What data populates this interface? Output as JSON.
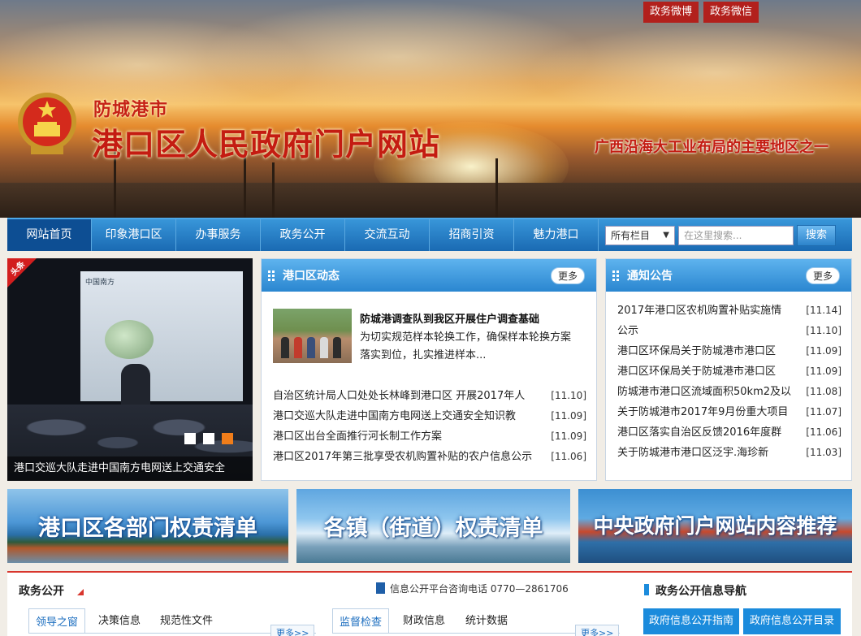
{
  "header": {
    "top_links": [
      "政务微博",
      "政务微信"
    ],
    "city": "防城港市",
    "site_title": "港口区人民政府门户网站",
    "slogan": "广西沿海大工业布局的主要地区之一"
  },
  "nav": {
    "items": [
      "网站首页",
      "印象港口区",
      "办事服务",
      "政务公开",
      "交流互动",
      "招商引资",
      "魅力港口"
    ],
    "active_index": 0,
    "select_value": "所有栏目",
    "search_placeholder": "在这里搜索...",
    "search_button": "搜索"
  },
  "slider": {
    "badge": "头条",
    "caption": "港口交巡大队走进中国南方电网送上交通安全",
    "screen_logo": "中国南方",
    "dots": 3,
    "active_dot": 2
  },
  "news_panel": {
    "title": "港口区动态",
    "more": "更多",
    "feature": {
      "title": "防城港调查队到我区开展住户调查基础",
      "text": "为切实规范样本轮换工作，确保样本轮换方案落实到位，扎实推进样本..."
    },
    "items": [
      {
        "title": "自治区统计局人口处处长林峰到港口区 开展2017年人",
        "date": "[11.10]"
      },
      {
        "title": "港口交巡大队走进中国南方电网送上交通安全知识教",
        "date": "[11.09]"
      },
      {
        "title": "港口区出台全面推行河长制工作方案",
        "date": "[11.09]"
      },
      {
        "title": "港口区2017年第三批享受农机购置补贴的农户信息公示",
        "date": "[11.06]"
      }
    ]
  },
  "notice_panel": {
    "title": "通知公告",
    "more": "更多",
    "items": [
      {
        "title": "2017年港口区农机购置补贴实施情",
        "date": "[11.14]"
      },
      {
        "title": "公示",
        "date": "[11.10]"
      },
      {
        "title": "港口区环保局关于防城港市港口区",
        "date": "[11.09]"
      },
      {
        "title": "港口区环保局关于防城港市港口区",
        "date": "[11.09]"
      },
      {
        "title": "防城港市港口区流域面积50km2及以",
        "date": "[11.08]"
      },
      {
        "title": "关于防城港市2017年9月份重大项目",
        "date": "[11.07]"
      },
      {
        "title": "港口区落实自治区反馈2016年度群",
        "date": "[11.06]"
      },
      {
        "title": "关于防城港市港口区泛宇.海珍新",
        "date": "[11.03]"
      }
    ]
  },
  "banners": [
    "港口区各部门权责清单",
    "各镇（街道）权责清单",
    "中央政府门户网站内容推荐"
  ],
  "bottom": {
    "section_title": "政务公开",
    "phone_label": "信息公开平台咨询电话 0770—2861706",
    "tabs_left": [
      "领导之窗",
      "决策信息",
      "规范性文件"
    ],
    "tabs_right": [
      "监督检查",
      "财政信息",
      "统计数据"
    ],
    "more": "更多>>",
    "guide_title": "政务公开信息导航",
    "guide_buttons": [
      "政府信息公开指南",
      "政府信息公开目录"
    ]
  },
  "colors": {
    "brand_red": "#c41c12",
    "nav_blue": "#1a6ab3",
    "accent_orange": "#f07d1a"
  }
}
